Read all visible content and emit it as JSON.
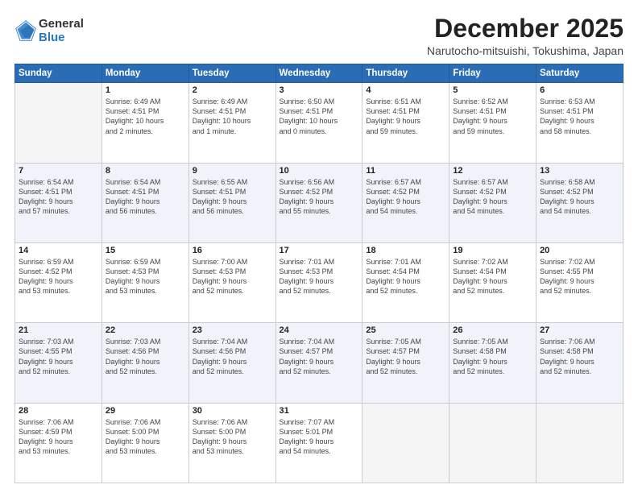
{
  "logo": {
    "general": "General",
    "blue": "Blue"
  },
  "header": {
    "month": "December 2025",
    "location": "Narutocho-mitsuishi, Tokushima, Japan"
  },
  "weekdays": [
    "Sunday",
    "Monday",
    "Tuesday",
    "Wednesday",
    "Thursday",
    "Friday",
    "Saturday"
  ],
  "weeks": [
    [
      {
        "day": "",
        "info": ""
      },
      {
        "day": "1",
        "info": "Sunrise: 6:49 AM\nSunset: 4:51 PM\nDaylight: 10 hours\nand 2 minutes."
      },
      {
        "day": "2",
        "info": "Sunrise: 6:49 AM\nSunset: 4:51 PM\nDaylight: 10 hours\nand 1 minute."
      },
      {
        "day": "3",
        "info": "Sunrise: 6:50 AM\nSunset: 4:51 PM\nDaylight: 10 hours\nand 0 minutes."
      },
      {
        "day": "4",
        "info": "Sunrise: 6:51 AM\nSunset: 4:51 PM\nDaylight: 9 hours\nand 59 minutes."
      },
      {
        "day": "5",
        "info": "Sunrise: 6:52 AM\nSunset: 4:51 PM\nDaylight: 9 hours\nand 59 minutes."
      },
      {
        "day": "6",
        "info": "Sunrise: 6:53 AM\nSunset: 4:51 PM\nDaylight: 9 hours\nand 58 minutes."
      }
    ],
    [
      {
        "day": "7",
        "info": "Sunrise: 6:54 AM\nSunset: 4:51 PM\nDaylight: 9 hours\nand 57 minutes."
      },
      {
        "day": "8",
        "info": "Sunrise: 6:54 AM\nSunset: 4:51 PM\nDaylight: 9 hours\nand 56 minutes."
      },
      {
        "day": "9",
        "info": "Sunrise: 6:55 AM\nSunset: 4:51 PM\nDaylight: 9 hours\nand 56 minutes."
      },
      {
        "day": "10",
        "info": "Sunrise: 6:56 AM\nSunset: 4:52 PM\nDaylight: 9 hours\nand 55 minutes."
      },
      {
        "day": "11",
        "info": "Sunrise: 6:57 AM\nSunset: 4:52 PM\nDaylight: 9 hours\nand 54 minutes."
      },
      {
        "day": "12",
        "info": "Sunrise: 6:57 AM\nSunset: 4:52 PM\nDaylight: 9 hours\nand 54 minutes."
      },
      {
        "day": "13",
        "info": "Sunrise: 6:58 AM\nSunset: 4:52 PM\nDaylight: 9 hours\nand 54 minutes."
      }
    ],
    [
      {
        "day": "14",
        "info": "Sunrise: 6:59 AM\nSunset: 4:52 PM\nDaylight: 9 hours\nand 53 minutes."
      },
      {
        "day": "15",
        "info": "Sunrise: 6:59 AM\nSunset: 4:53 PM\nDaylight: 9 hours\nand 53 minutes."
      },
      {
        "day": "16",
        "info": "Sunrise: 7:00 AM\nSunset: 4:53 PM\nDaylight: 9 hours\nand 52 minutes."
      },
      {
        "day": "17",
        "info": "Sunrise: 7:01 AM\nSunset: 4:53 PM\nDaylight: 9 hours\nand 52 minutes."
      },
      {
        "day": "18",
        "info": "Sunrise: 7:01 AM\nSunset: 4:54 PM\nDaylight: 9 hours\nand 52 minutes."
      },
      {
        "day": "19",
        "info": "Sunrise: 7:02 AM\nSunset: 4:54 PM\nDaylight: 9 hours\nand 52 minutes."
      },
      {
        "day": "20",
        "info": "Sunrise: 7:02 AM\nSunset: 4:55 PM\nDaylight: 9 hours\nand 52 minutes."
      }
    ],
    [
      {
        "day": "21",
        "info": "Sunrise: 7:03 AM\nSunset: 4:55 PM\nDaylight: 9 hours\nand 52 minutes."
      },
      {
        "day": "22",
        "info": "Sunrise: 7:03 AM\nSunset: 4:56 PM\nDaylight: 9 hours\nand 52 minutes."
      },
      {
        "day": "23",
        "info": "Sunrise: 7:04 AM\nSunset: 4:56 PM\nDaylight: 9 hours\nand 52 minutes."
      },
      {
        "day": "24",
        "info": "Sunrise: 7:04 AM\nSunset: 4:57 PM\nDaylight: 9 hours\nand 52 minutes."
      },
      {
        "day": "25",
        "info": "Sunrise: 7:05 AM\nSunset: 4:57 PM\nDaylight: 9 hours\nand 52 minutes."
      },
      {
        "day": "26",
        "info": "Sunrise: 7:05 AM\nSunset: 4:58 PM\nDaylight: 9 hours\nand 52 minutes."
      },
      {
        "day": "27",
        "info": "Sunrise: 7:06 AM\nSunset: 4:58 PM\nDaylight: 9 hours\nand 52 minutes."
      }
    ],
    [
      {
        "day": "28",
        "info": "Sunrise: 7:06 AM\nSunset: 4:59 PM\nDaylight: 9 hours\nand 53 minutes."
      },
      {
        "day": "29",
        "info": "Sunrise: 7:06 AM\nSunset: 5:00 PM\nDaylight: 9 hours\nand 53 minutes."
      },
      {
        "day": "30",
        "info": "Sunrise: 7:06 AM\nSunset: 5:00 PM\nDaylight: 9 hours\nand 53 minutes."
      },
      {
        "day": "31",
        "info": "Sunrise: 7:07 AM\nSunset: 5:01 PM\nDaylight: 9 hours\nand 54 minutes."
      },
      {
        "day": "",
        "info": ""
      },
      {
        "day": "",
        "info": ""
      },
      {
        "day": "",
        "info": ""
      }
    ]
  ]
}
